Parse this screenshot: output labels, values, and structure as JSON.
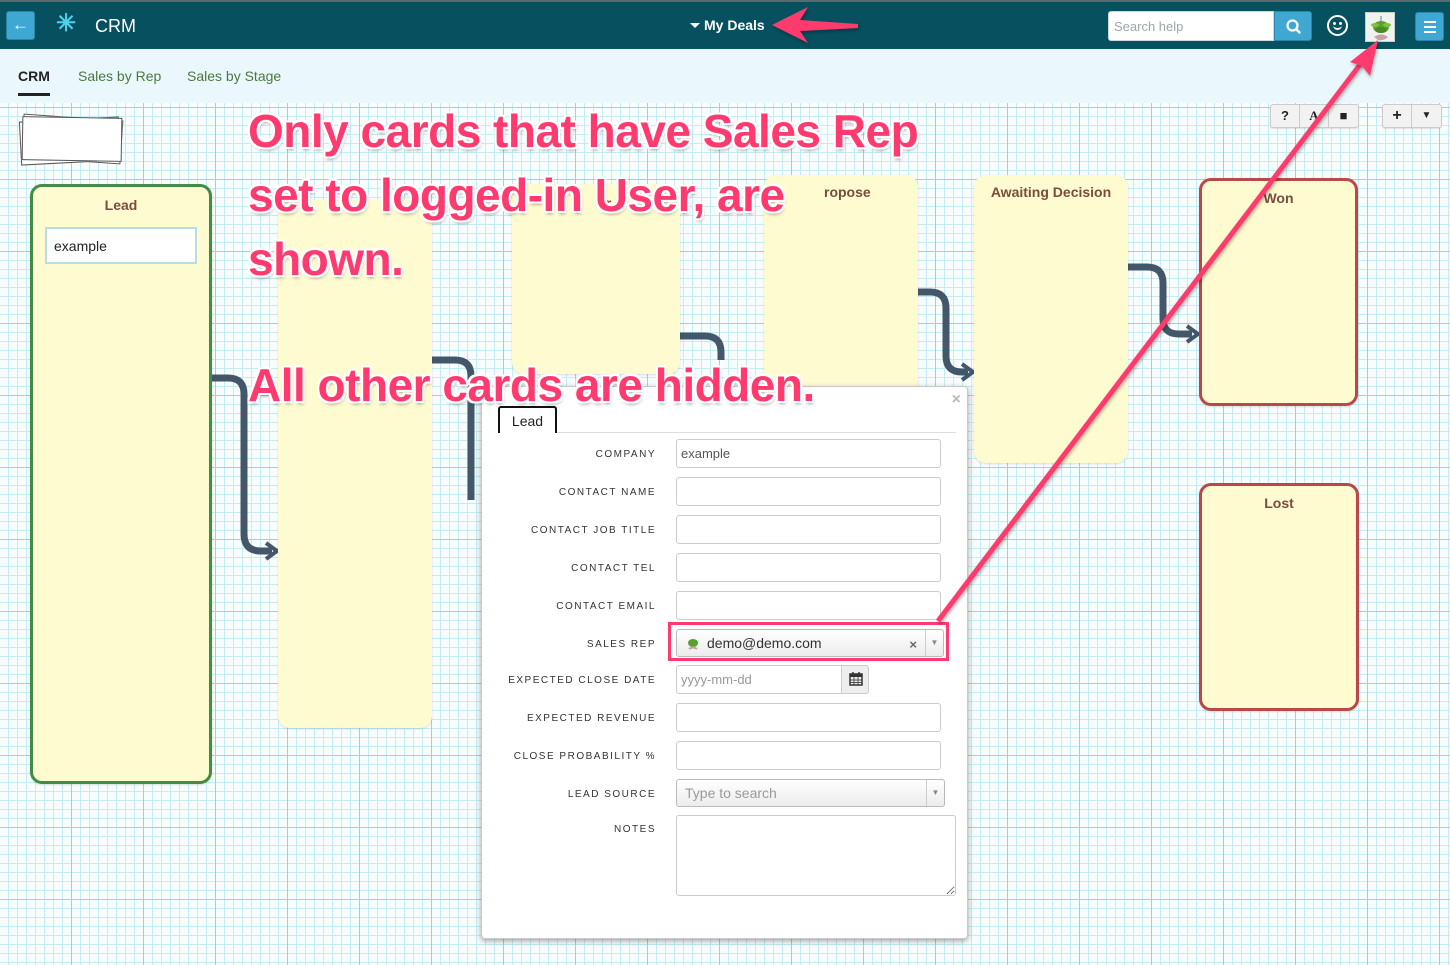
{
  "topbar": {
    "back_icon": "arrow-left-icon",
    "app_icon": "asterisk-icon",
    "app_title": "CRM",
    "view_selector": "My Deals",
    "search_placeholder": "Search help",
    "search_icon": "search-icon",
    "feedback_icon": "smiley-icon",
    "avatar_icon": "user-avatar",
    "menu_icon": "hamburger-menu-icon"
  },
  "tabs": [
    {
      "label": "CRM",
      "active": true
    },
    {
      "label": "Sales by Rep",
      "active": false
    },
    {
      "label": "Sales by Stage",
      "active": false
    }
  ],
  "toolbar": {
    "help": "?",
    "font": "A",
    "square": "■",
    "add": "+",
    "filter": "▼"
  },
  "stages": [
    {
      "title": "Lead",
      "cards": [
        "example"
      ]
    },
    {
      "title": "",
      "cards": []
    },
    {
      "title": "ir",
      "cards": []
    },
    {
      "title": "ropose",
      "cards": []
    },
    {
      "title": "Awaiting Decision",
      "cards": []
    },
    {
      "title": "Won",
      "cards": []
    },
    {
      "title": "Lost",
      "cards": []
    }
  ],
  "dialog": {
    "tab": "Lead",
    "close": "×",
    "fields": {
      "company": {
        "label": "COMPANY",
        "value": "example"
      },
      "contact_name": {
        "label": "CONTACT NAME",
        "value": ""
      },
      "contact_job_title": {
        "label": "CONTACT JOB TITLE",
        "value": ""
      },
      "contact_tel": {
        "label": "CONTACT TEL",
        "value": ""
      },
      "contact_email": {
        "label": "CONTACT EMAIL",
        "value": ""
      },
      "sales_rep": {
        "label": "SALES REP",
        "value": "demo@demo.com",
        "clear": "×",
        "arrow": "▼"
      },
      "expected_close_date": {
        "label": "EXPECTED CLOSE DATE",
        "placeholder": "yyyy-mm-dd"
      },
      "expected_revenue": {
        "label": "EXPECTED REVENUE",
        "value": ""
      },
      "close_probability": {
        "label": "CLOSE PROBABILITY %",
        "value": ""
      },
      "lead_source": {
        "label": "LEAD SOURCE",
        "placeholder": "Type to search",
        "arrow": "▼"
      },
      "notes": {
        "label": "NOTES",
        "value": ""
      }
    }
  },
  "annotations": {
    "line1": "Only cards that have Sales Rep",
    "line2": "set to logged-in User, are",
    "line3": "shown.",
    "line4": "All other cards are hidden.",
    "color": "#ff3a6e"
  }
}
